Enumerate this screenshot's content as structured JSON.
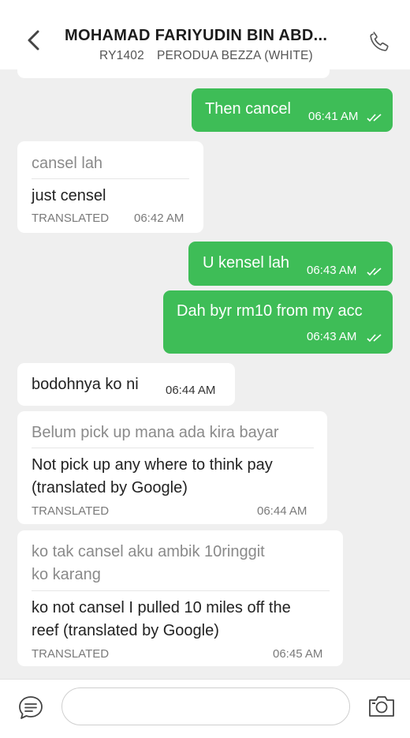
{
  "header": {
    "title": "MOHAMAD FARIYUDIN BIN ABD...",
    "plate": "RY1402",
    "vehicle": "PERODUA BEZZA (WHITE)"
  },
  "messages": [
    {
      "direction": "incoming",
      "partial": true
    },
    {
      "direction": "outgoing",
      "text": "Then cancel",
      "time": "06:41 AM",
      "read": true
    },
    {
      "direction": "incoming",
      "original": "cansel lah",
      "text": "just censel",
      "status": "TRANSLATED",
      "time": "06:42 AM"
    },
    {
      "direction": "outgoing",
      "text": "U kensel lah",
      "time": "06:43 AM",
      "read": true
    },
    {
      "direction": "outgoing",
      "text": "Dah byr rm10 from my acc",
      "time": "06:43 AM",
      "read": true
    },
    {
      "direction": "incoming",
      "text": "bodohnya ko ni",
      "time": "06:44 AM"
    },
    {
      "direction": "incoming",
      "original": "Belum pick up mana ada kira bayar",
      "text_lines": [
        "Not pick up any where to think pay",
        "(translated by Google)"
      ],
      "status": "TRANSLATED",
      "time": "06:44 AM"
    },
    {
      "direction": "incoming",
      "original_lines": [
        "ko tak cansel aku ambik 10ringgit",
        "ko karang"
      ],
      "text_lines": [
        "ko not cansel I pulled 10 miles off the",
        "reef (translated by Google)"
      ],
      "status": "TRANSLATED",
      "time": "06:45 AM"
    }
  ],
  "composer": {
    "placeholder": ""
  },
  "icons": {
    "back": "chevron-left-icon",
    "call": "phone-icon",
    "quick_reply": "chat-bubble-icon",
    "attach_photo": "camera-icon"
  },
  "colors": {
    "outgoing_bubble": "#3ebd57",
    "incoming_bubble": "#ffffff",
    "chat_background": "#efefef"
  }
}
